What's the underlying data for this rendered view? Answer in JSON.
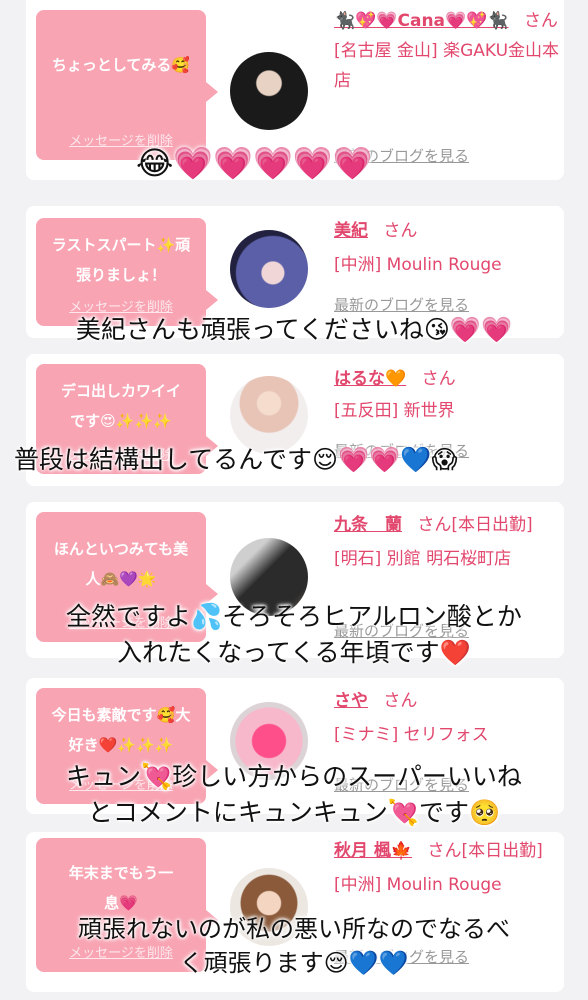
{
  "cards": [
    {
      "message": "ちょっとしてみる🥰",
      "delete_label": "メッセージを削除",
      "name": "🐈‍⬛💖💗Cana💗💖🐈‍⬛",
      "suffix": "さん",
      "shop": "[名古屋 金山] 楽GAKU金山本店",
      "blog_label": "最新のブログを見る"
    },
    {
      "message": "ラストスパート✨頑張りましょ！",
      "delete_label": "メッセージを削除",
      "name": "美紀",
      "suffix": "さん",
      "shop": "[中洲] Moulin Rouge",
      "blog_label": "最新のブログを見る"
    },
    {
      "message": "デコ出しカワイイです😍✨✨✨",
      "delete_label": "メッセージを削除",
      "name": "はるな🧡",
      "suffix": "さん",
      "shop": "[五反田] 新世界",
      "blog_label": "最新のブログを見る"
    },
    {
      "message": "ほんといつみても美人🙈💜🌟",
      "delete_label": "メッセージを削除",
      "name": "九条　蘭",
      "suffix": "さん[本日出勤]",
      "shop": "[明石] 別館 明石桜町店",
      "blog_label": "最新のブログを見る"
    },
    {
      "message": "今日も素敵です🥰大好き❤️✨✨✨",
      "delete_label": "メッセージを削除",
      "name": "さや",
      "suffix": "さん",
      "shop": "[ミナミ] セリフォス",
      "blog_label": "最新のブログを見る"
    },
    {
      "message": "年末までもう一息💗",
      "delete_label": "メッセージを削除",
      "name": "秋月 楓🍁",
      "suffix": "さん[本日出勤]",
      "shop": "[中洲] Moulin Rouge",
      "blog_label": "最新のブログを見る"
    }
  ],
  "overlays": {
    "line1": "😂💗💗💗💗💗",
    "line2": "美紀さんも頑張ってくださいね😘💗💗",
    "line3_text": "普段は結構出してるんです😌",
    "line3_emoji": "💗💗💙😱",
    "line4a": "全然ですよ💦そろそろヒアルロン酸とか",
    "line4b": "入れたくなってくる年頃です❤️",
    "line5a": "キュン💘珍しい方からのスーパーいいね",
    "line5b": "とコメントにキュンキュン💘です🥺",
    "line6a": "頑張れないのが私の悪い所なのでなるべ",
    "line6b": "く頑張ります😌💙💙"
  },
  "colors": {
    "accent": "#e2486e",
    "bubble": "#f8a4b3"
  }
}
